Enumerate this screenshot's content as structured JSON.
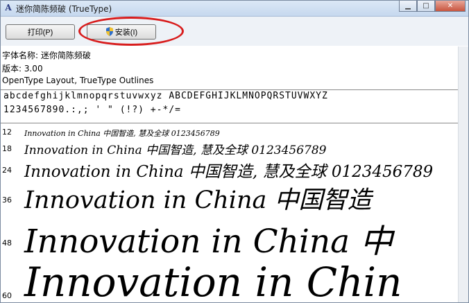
{
  "window": {
    "title": "迷你简陈频破 (TrueType)"
  },
  "toolbar": {
    "print_label": "打印(P)",
    "install_label": "安装(I)"
  },
  "info": {
    "font_name": "字体名称: 迷你简陈频破",
    "version": "版本: 3.00",
    "outline": "OpenType Layout, TrueType Outlines"
  },
  "charset": {
    "line1": "abcdefghijklmnopqrstuvwxyz ABCDEFGHIJKLMNOPQRSTUVWXYZ",
    "line2": "1234567890.:,; ' \" (!?) +-*/="
  },
  "samples": [
    {
      "size": "12",
      "text": "Innovation in China 中国智造, 慧及全球 0123456789"
    },
    {
      "size": "18",
      "text": "Innovation in China 中国智造, 慧及全球 0123456789"
    },
    {
      "size": "24",
      "text": "Innovation in China 中国智造, 慧及全球 0123456789"
    },
    {
      "size": "36",
      "text": "Innovation in China 中国智造"
    },
    {
      "size": "48",
      "text": "Innovation in China 中"
    },
    {
      "size": "60",
      "text": "Innovation in Chin"
    }
  ],
  "colors": {
    "annotation": "#d81c1c"
  }
}
